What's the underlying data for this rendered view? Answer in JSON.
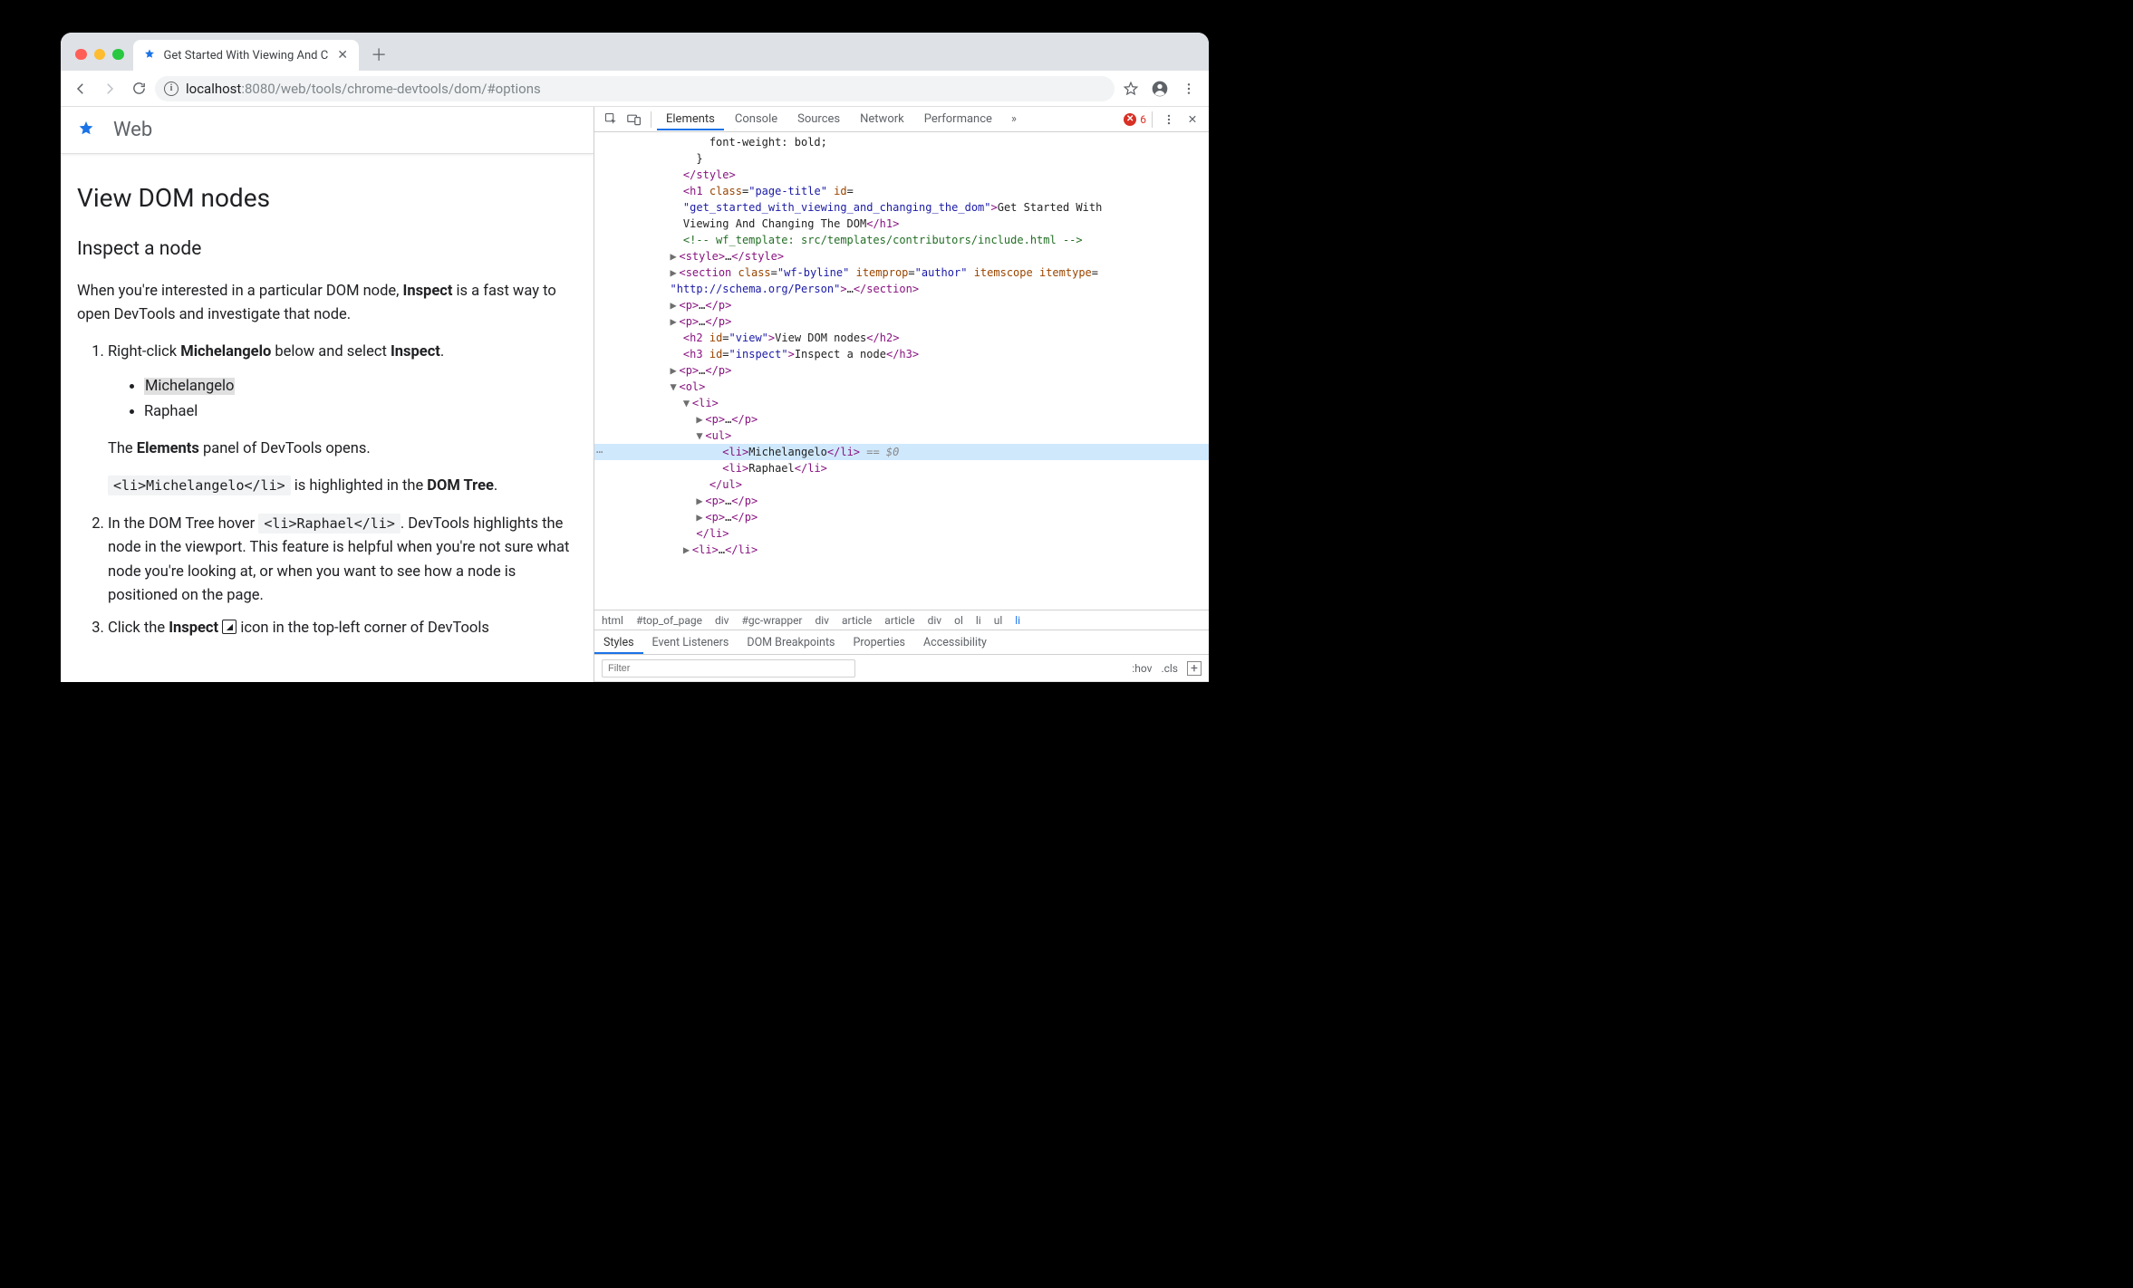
{
  "browser": {
    "tab_title": "Get Started With Viewing And C",
    "url_host": "localhost",
    "url_port": ":8080",
    "url_path": "/web/tools/chrome-devtools/dom/#options"
  },
  "page": {
    "brand": "Web",
    "h1": "View DOM nodes",
    "h2": "Inspect a node",
    "intro_pre": "When you're interested in a particular DOM node, ",
    "intro_bold": "Inspect",
    "intro_post": " is a fast way to open DevTools and investigate that node.",
    "step1_a": "Right-click ",
    "step1_b": "Michelangelo",
    "step1_c": " below and select ",
    "step1_d": "Inspect",
    "step1_e": ".",
    "artist1": "Michelangelo",
    "artist2": "Raphael",
    "step1_r1a": "The ",
    "step1_r1b": "Elements",
    "step1_r1c": " panel of DevTools opens.",
    "step1_r2_code": "<li>Michelangelo</li>",
    "step1_r2_mid": " is highlighted in the ",
    "step1_r2_b": "DOM Tree",
    "step1_r2_end": ".",
    "step2_a": "In the DOM Tree hover ",
    "step2_code": "<li>Raphael</li>",
    "step2_b": ". DevTools highlights the node in the viewport. This feature is helpful when you're not sure what node you're looking at, or when you want to see how a node is positioned on the page.",
    "step3_a": "Click the ",
    "step3_b": "Inspect",
    "step3_c": " icon in the top-left corner of DevTools"
  },
  "devtools": {
    "tabs": [
      "Elements",
      "Console",
      "Sources",
      "Network",
      "Performance"
    ],
    "error_count": "6",
    "breadcrumb": [
      "html",
      "#top_of_page",
      "div",
      "#gc-wrapper",
      "div",
      "article",
      "article",
      "div",
      "ol",
      "li",
      "ul",
      "li"
    ],
    "styles_tabs": [
      "Styles",
      "Event Listeners",
      "DOM Breakpoints",
      "Properties",
      "Accessibility"
    ],
    "filter_placeholder": "Filter",
    "hov": ":hov",
    "cls": ".cls",
    "dom": {
      "l0": "font-weight: bold;",
      "l1": "}",
      "h1_class": "page-title",
      "h1_id": "get_started_with_viewing_and_changing_the_dom",
      "h1_text": "Get Started With Viewing And Changing The DOM",
      "comment": "<!-- wf_template: src/templates/contributors/include.html -->",
      "section_class": "wf-byline",
      "section_itemprop": "author",
      "section_itemtype": "http://schema.org/Person",
      "h2_id": "view",
      "h2_text": "View DOM nodes",
      "h3_id": "inspect",
      "h3_text": "Inspect a node",
      "li_sel": "Michelangelo",
      "li_sel_suffix": " == $0",
      "li2": "Raphael"
    }
  }
}
